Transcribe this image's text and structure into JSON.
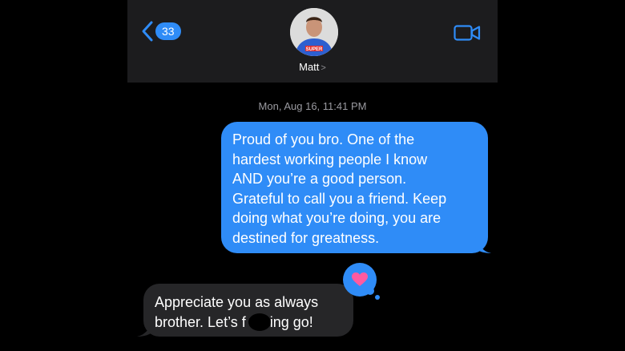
{
  "header": {
    "back_count": "33",
    "contact_name": "Matt",
    "contact_chevron": ">",
    "avatar_shirt_text": "SUPER",
    "back_icon": "chevron-left-icon",
    "video_icon": "video-camera-icon"
  },
  "conversation": {
    "timestamp": "Mon, Aug 16, 11:41 PM",
    "messages": [
      {
        "direction": "outgoing",
        "lines": [
          "Proud of you bro. One of the",
          "hardest working people I know",
          "AND you’re a good person.",
          "Grateful to call you a friend. Keep",
          "doing what you’re doing, you are",
          "destined for greatness."
        ]
      },
      {
        "direction": "incoming",
        "lines": [
          "Appreciate you as always",
          "brother. Let’s f      ing go!"
        ],
        "tapback": "heart-icon"
      }
    ]
  },
  "colors": {
    "accent": "#2f8cf7",
    "header_bg": "#1c1c1e",
    "incoming_bubble": "#262628",
    "background": "#000000",
    "heart": "#ff5aa0"
  }
}
